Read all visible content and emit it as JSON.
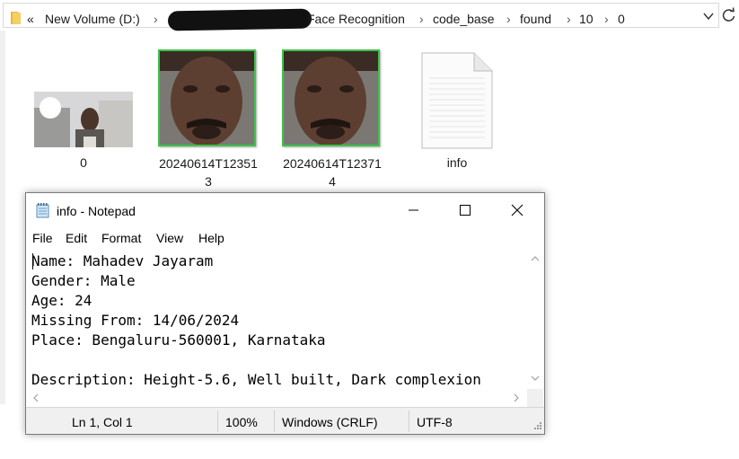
{
  "address_bar": {
    "nav_chevron": "«",
    "crumbs": [
      "New Volume (D:)",
      "Face Recognition",
      "code_base",
      "found",
      "10",
      "0"
    ],
    "separator": "›"
  },
  "files": [
    {
      "name": "0",
      "type": "image"
    },
    {
      "name_line1": "20240614T12351",
      "name_line2": "3",
      "type": "image"
    },
    {
      "name_line1": "20240614T12371",
      "name_line2": "4",
      "type": "image"
    },
    {
      "name": "info",
      "type": "text-document"
    }
  ],
  "notepad": {
    "title": "info - Notepad",
    "menu": [
      "File",
      "Edit",
      "Format",
      "View",
      "Help"
    ],
    "lines": [
      "Name: Mahadev Jayaram",
      "Gender: Male",
      "Age: 24",
      "Missing From: 14/06/2024",
      "Place: Bengaluru-560001, Karnataka",
      "",
      "Description: Height-5.6, Well built, Dark complexion"
    ],
    "status": {
      "position": "Ln 1, Col 1",
      "zoom": "100%",
      "line_ending": "Windows (CRLF)",
      "encoding": "UTF-8"
    }
  },
  "colors": {
    "face_box": "#3cc24a",
    "folder": "#e8b844"
  }
}
